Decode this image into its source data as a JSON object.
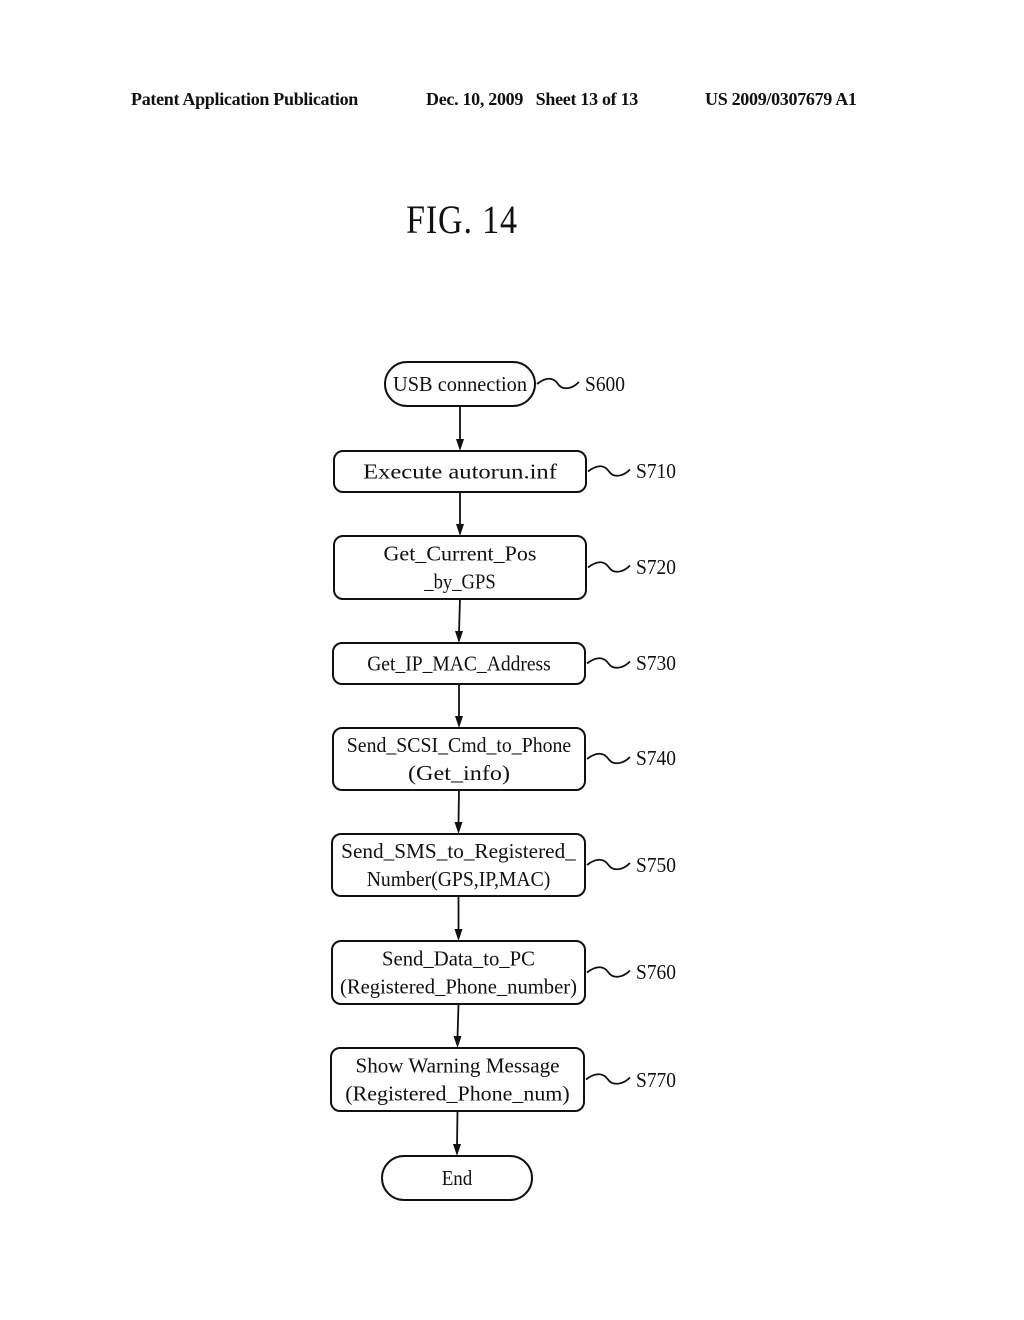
{
  "header": {
    "left": "Patent Application Publication",
    "middle": "Dec. 10, 2009   Sheet 13 of 13",
    "right": "US 2009/0307679 A1"
  },
  "figure": {
    "title": "FIG. 14"
  },
  "flowchart": {
    "nodes": [
      {
        "id": "S600",
        "shape": "terminal",
        "lines": [
          "USB connection"
        ],
        "ref": "S600"
      },
      {
        "id": "S710",
        "shape": "process",
        "lines": [
          "Execute autorun.inf"
        ],
        "ref": "S710"
      },
      {
        "id": "S720",
        "shape": "process",
        "lines": [
          "Get_Current_Pos",
          "_by_GPS"
        ],
        "ref": "S720"
      },
      {
        "id": "S730",
        "shape": "process",
        "lines": [
          "Get_IP_MAC_Address"
        ],
        "ref": "S730"
      },
      {
        "id": "S740",
        "shape": "process",
        "lines": [
          "Send_SCSI_Cmd_to_Phone",
          "(Get_info)"
        ],
        "ref": "S740"
      },
      {
        "id": "S750",
        "shape": "process",
        "lines": [
          "Send_SMS_to_Registered_",
          "Number(GPS,IP,MAC)"
        ],
        "ref": "S750"
      },
      {
        "id": "S760",
        "shape": "process",
        "lines": [
          "Send_Data_to_PC",
          "(Registered_Phone_number)"
        ],
        "ref": "S760"
      },
      {
        "id": "S770",
        "shape": "process",
        "lines": [
          "Show Warning Message",
          "(Registered_Phone_num)"
        ],
        "ref": "S770"
      },
      {
        "id": "END",
        "shape": "terminal",
        "lines": [
          "End"
        ],
        "ref": ""
      }
    ],
    "edges": [
      [
        "S600",
        "S710"
      ],
      [
        "S710",
        "S720"
      ],
      [
        "S720",
        "S730"
      ],
      [
        "S730",
        "S740"
      ],
      [
        "S740",
        "S750"
      ],
      [
        "S750",
        "S760"
      ],
      [
        "S760",
        "S770"
      ],
      [
        "S770",
        "END"
      ]
    ]
  }
}
